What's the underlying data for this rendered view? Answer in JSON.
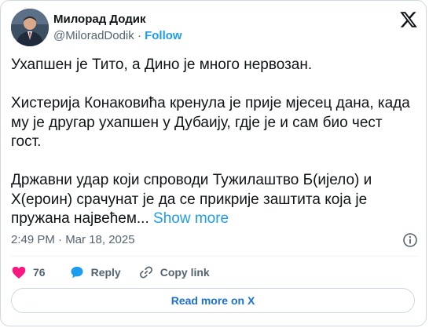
{
  "author": {
    "display_name": "Милорад Додик",
    "handle": "@MiloradDodik",
    "separator": "·",
    "follow_label": "Follow"
  },
  "tweet": {
    "paragraphs": [
      "Ухапшен је Тито, а Дино је много нервозан.",
      "Хистерија Конаковића кренула је прије мјесец дана, када му је другар ухапшен у Дубаију, гдје је и сам био чест гост.",
      "Државни удар који спроводи Тужилаштво Б(ијело) и Х(ероин) срачунат је да се прикрије заштита која је пружана највећем..."
    ],
    "show_more_label": "Show more",
    "timestamp": "2:49 PM · Mar 18, 2025"
  },
  "actions": {
    "like_count": "76",
    "reply_label": "Reply",
    "copy_link_label": "Copy link"
  },
  "read_more_label": "Read more on X",
  "colors": {
    "accent": "#1d9bf0",
    "like": "#f91880",
    "reply": "#1d9bf0",
    "muted": "#536471",
    "border": "#cfd9de"
  },
  "icons": {
    "logo": "x-logo-icon",
    "info": "info-icon",
    "like": "heart-icon",
    "reply": "speech-bubble-icon",
    "copy": "link-icon"
  }
}
